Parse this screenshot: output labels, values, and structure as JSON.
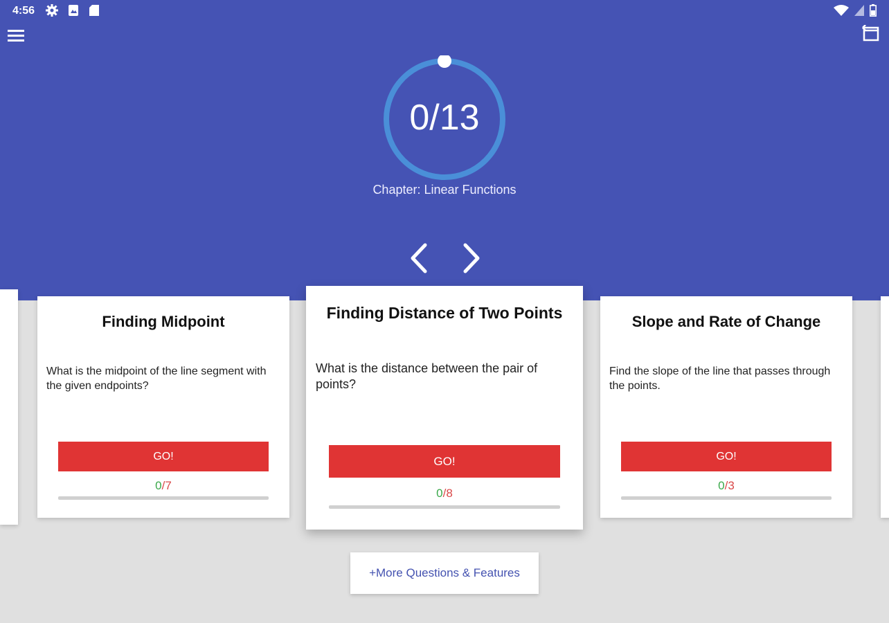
{
  "status_bar": {
    "time": "4:56"
  },
  "header": {
    "menu_icon": "hamburger-menu-icon",
    "restart_icon": "restart-icon",
    "progress": {
      "completed": "0",
      "total": "13",
      "text": "0/13",
      "fraction": 0
    },
    "chapter": "Chapter: Linear Functions",
    "prev_icon": "chevron-left-icon",
    "next_icon": "chevron-right-icon"
  },
  "cards": [
    {
      "title": "Finding Midpoint",
      "description": "What is the midpoint of the line segment with the given endpoints?",
      "button": "GO!",
      "done": "0",
      "sep": "/",
      "total": "7",
      "fraction": 0
    },
    {
      "title": "Finding Distance of Two Points",
      "description": "What is the distance between the pair of points?",
      "button": "GO!",
      "done": "0",
      "sep": "/",
      "total": "8",
      "fraction": 0
    },
    {
      "title": "Slope and Rate of Change",
      "description": "Find the slope of the line that passes through the points.",
      "button": "GO!",
      "done": "0",
      "sep": "/",
      "total": "3",
      "fraction": 0
    }
  ],
  "more_button": "+More Questions & Features",
  "colors": {
    "header": "#4553b4",
    "ring": "#4a8fd8",
    "go_button": "#e03434",
    "done": "#3aa84a",
    "total": "#d94848",
    "background": "#e0e0e0"
  }
}
